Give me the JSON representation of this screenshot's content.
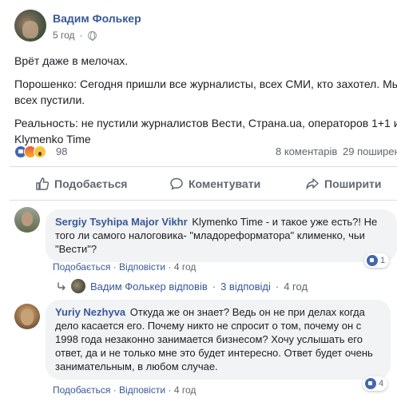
{
  "post": {
    "author": "Вадим Фолькер",
    "time": "5 год",
    "paragraphs": [
      "Врёт даже в мелочах.",
      "Порошенко: Сегодня пришли все журналисты, всех СМИ, кто захотел. Мы",
      "всех пустили.",
      "Реальность: не пустили журналистов Вести, Страна.ua, операторов 1+1 и",
      "Klymenko Time"
    ]
  },
  "stats": {
    "reactions": "98",
    "comments": "8 коментарів",
    "shares": "29 поширен"
  },
  "actions": {
    "like": "Подобається",
    "comment": "Коментувати",
    "share": "Поширити"
  },
  "comments": [
    {
      "author": "Sergiy Tsyhipa Major Vikhr",
      "text_line1": "Klymenko Time - и такое уже есть?! Не",
      "text_line2": "того ли самого налоговика- \"младореформатора\" клименко, чьи",
      "text_line3": "\"Вести\"?",
      "like": "Подобається",
      "reply": "Відповісти",
      "time": "4 год",
      "likes": "1"
    },
    {
      "author": "Yuriy Nezhyva",
      "text_line1": "Откуда же он знает? Ведь он не при делах когда",
      "text_line2": "дело касается его. Почему никто не спросит о том, почему он с",
      "text_line3": "1998 года незаконно занимается бизнесом? Хочу услышать его",
      "text_line4": "ответ, да и не только мне это будет интересно. Ответ будет очень",
      "text_line5": "занимательным, в любом случае.",
      "like": "Подобається",
      "reply": "Відповісти",
      "time": "4 год",
      "likes": "4"
    }
  ],
  "replies": {
    "author_replied": "Вадим Фолькер відповів",
    "count": "3 відповіді",
    "time": "4 год"
  },
  "separator": "·",
  "colors": {
    "link": "#385898",
    "meta": "#606770",
    "bubble": "#f2f3f5",
    "like_blue": "#4267b2"
  }
}
